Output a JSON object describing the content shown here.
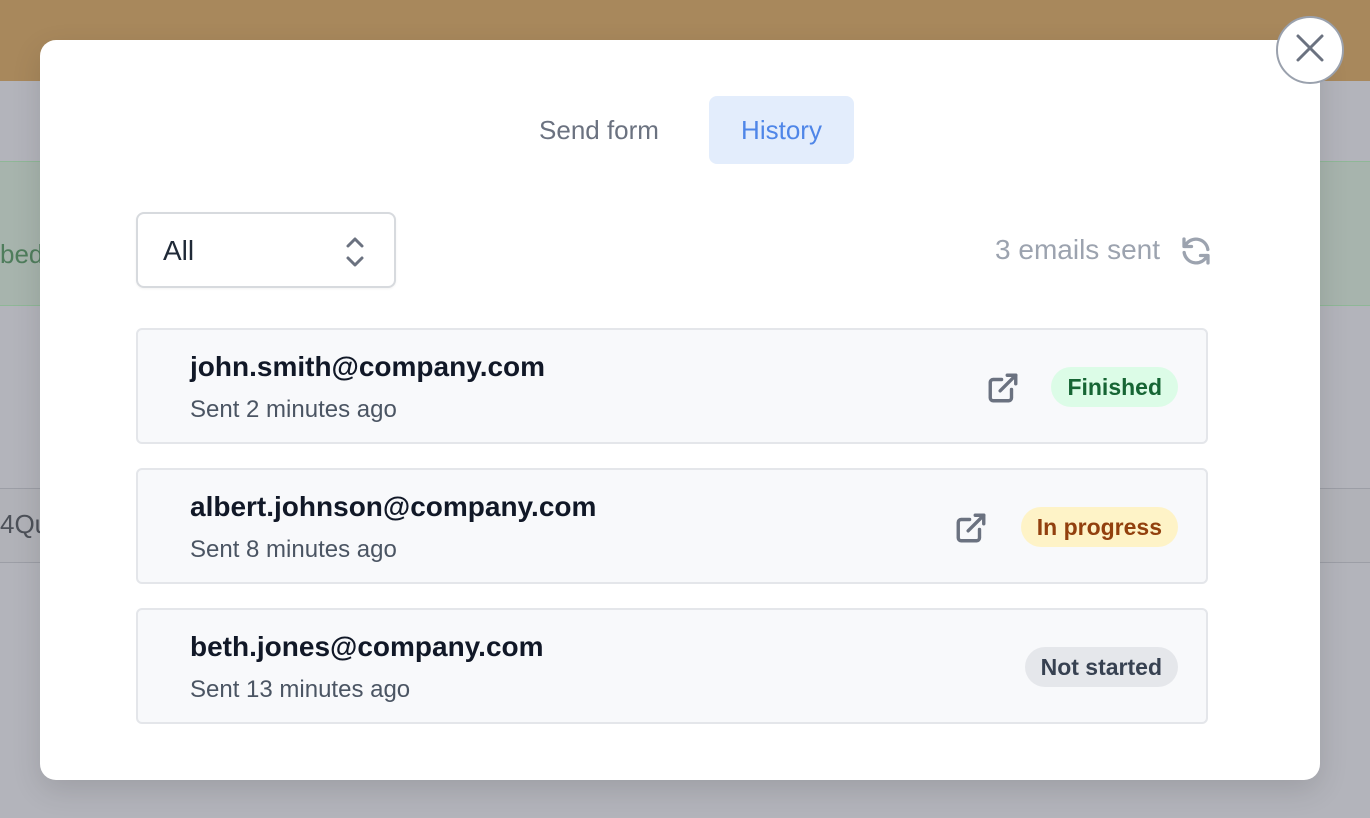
{
  "background": {
    "banner_fragment": "bed",
    "row_fragment": "4Qu"
  },
  "modal": {
    "tabs": [
      {
        "label": "Send form",
        "active": false
      },
      {
        "label": "History",
        "active": true
      }
    ],
    "filter": {
      "selected": "All"
    },
    "count_label": "3 emails sent",
    "items": [
      {
        "email": "john.smith@company.com",
        "sent": "Sent 2 minutes ago",
        "status": "Finished",
        "has_link": true
      },
      {
        "email": "albert.johnson@company.com",
        "sent": "Sent 8 minutes ago",
        "status": "In progress",
        "has_link": true
      },
      {
        "email": "beth.jones@company.com",
        "sent": "Sent 13 minutes ago",
        "status": "Not started",
        "has_link": false
      }
    ],
    "icons": {
      "close": "close-icon",
      "refresh": "refresh-icon",
      "external_link": "external-link-icon",
      "select": "chevron-up-down-icon"
    },
    "colors": {
      "accent": "#4f86e8",
      "finished": "#166534",
      "in_progress": "#92400e",
      "not_started": "#374151"
    }
  }
}
